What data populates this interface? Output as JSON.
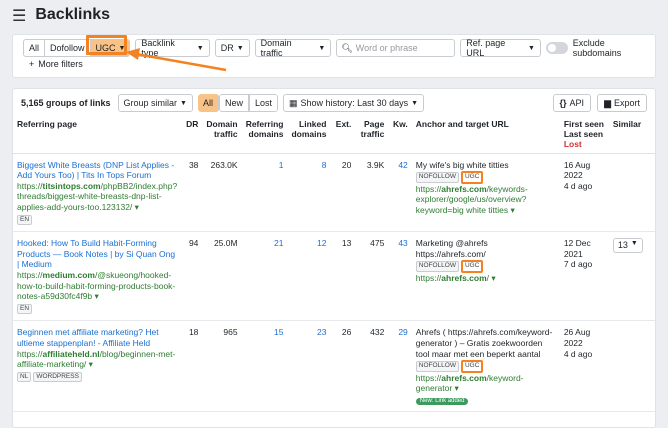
{
  "header": {
    "title": "Backlinks"
  },
  "filters": {
    "type_tabs": [
      "All",
      "Dofollow",
      "UGC"
    ],
    "backlink_type": "Backlink type",
    "dr": "DR",
    "domain_traffic": "Domain traffic",
    "search_placeholder": "Word or phrase",
    "ref_page_url": "Ref. page URL",
    "exclude_subdomains": "Exclude subdomains",
    "more_filters": "More filters"
  },
  "toolbar": {
    "count": "5,165 groups of links",
    "group": "Group similar",
    "tabs": [
      "All",
      "New",
      "Lost"
    ],
    "history": "Show history: Last 30 days",
    "api": "API",
    "export": "Export"
  },
  "columns": [
    "Referring page",
    "DR",
    "Domain traffic",
    "Referring domains",
    "Linked domains",
    "Ext.",
    "Page traffic",
    "Kw.",
    "Anchor and target URL",
    "First seen Last seen",
    "Similar"
  ],
  "lost_label": "Lost",
  "rows": [
    {
      "title": "Biggest White Breasts (DNP List Applies - Add Yours Too) | Tits In Tops Forum",
      "url_pre": "https://",
      "url_bold": "titsintops.com",
      "url_post": "/phpBB2/index.php?threads/biggest-white-breasts-dnp-list-applies-add-yours-too.123132/ ▾",
      "lang": "EN",
      "dr": "38",
      "traffic": "263.0K",
      "ref": "1",
      "linked": "8",
      "ext": "20",
      "ptraffic": "3.9K",
      "kw": "42",
      "anchor": "My wife's big white titties",
      "target_pre": "https://",
      "target_bold": "ahrefs.com",
      "target_post": "/keywords-explorer/google/us/overview?keyword=big white titties ▾",
      "first": "16 Aug 2022",
      "last": "4 d ago",
      "similar": ""
    },
    {
      "title": "Hooked: How To Build Habit-Forming Products — Book Notes | by Si Quan Ong | Medium",
      "url_pre": "https://",
      "url_bold": "medium.com",
      "url_post": "/@skueong/hooked-how-to-build-habit-forming-products-book-notes-a59d30fc4f9b ▾",
      "lang": "EN",
      "dr": "94",
      "traffic": "25.0M",
      "ref": "21",
      "linked": "12",
      "ext": "13",
      "ptraffic": "475",
      "kw": "43",
      "anchor": "Marketing @ahrefs https://ahrefs.com/",
      "target_pre": "https://",
      "target_bold": "ahrefs.com",
      "target_post": "/ ▾",
      "first": "12 Dec 2021",
      "last": "7 d ago",
      "similar": "13"
    },
    {
      "title": "Beginnen met affiliate marketing? Het ultieme stappenplan! - Affiliate Held",
      "url_pre": "https://",
      "url_bold": "affiliateheld.nl",
      "url_post": "/blog/beginnen-met-affiliate-marketing/ ▾",
      "lang": "NL",
      "dr": "18",
      "traffic": "965",
      "ref": "15",
      "linked": "23",
      "ext": "26",
      "ptraffic": "432",
      "kw": "29",
      "anchor": "Ahrefs ( https://ahrefs.com/keyword-generator ) – Gratis zoekwoorden tool maar met een beperkt aantal",
      "target_pre": "https://",
      "target_bold": "ahrefs.com",
      "target_post": "/keyword-generator ▾",
      "first": "26 Aug 2022",
      "last": "4 d ago",
      "similar": ""
    }
  ],
  "tags": {
    "nofollow": "NOFOLLOW",
    "ugc": "UGC",
    "wordpress": "WORDPRESS",
    "new": "New: Link added"
  }
}
